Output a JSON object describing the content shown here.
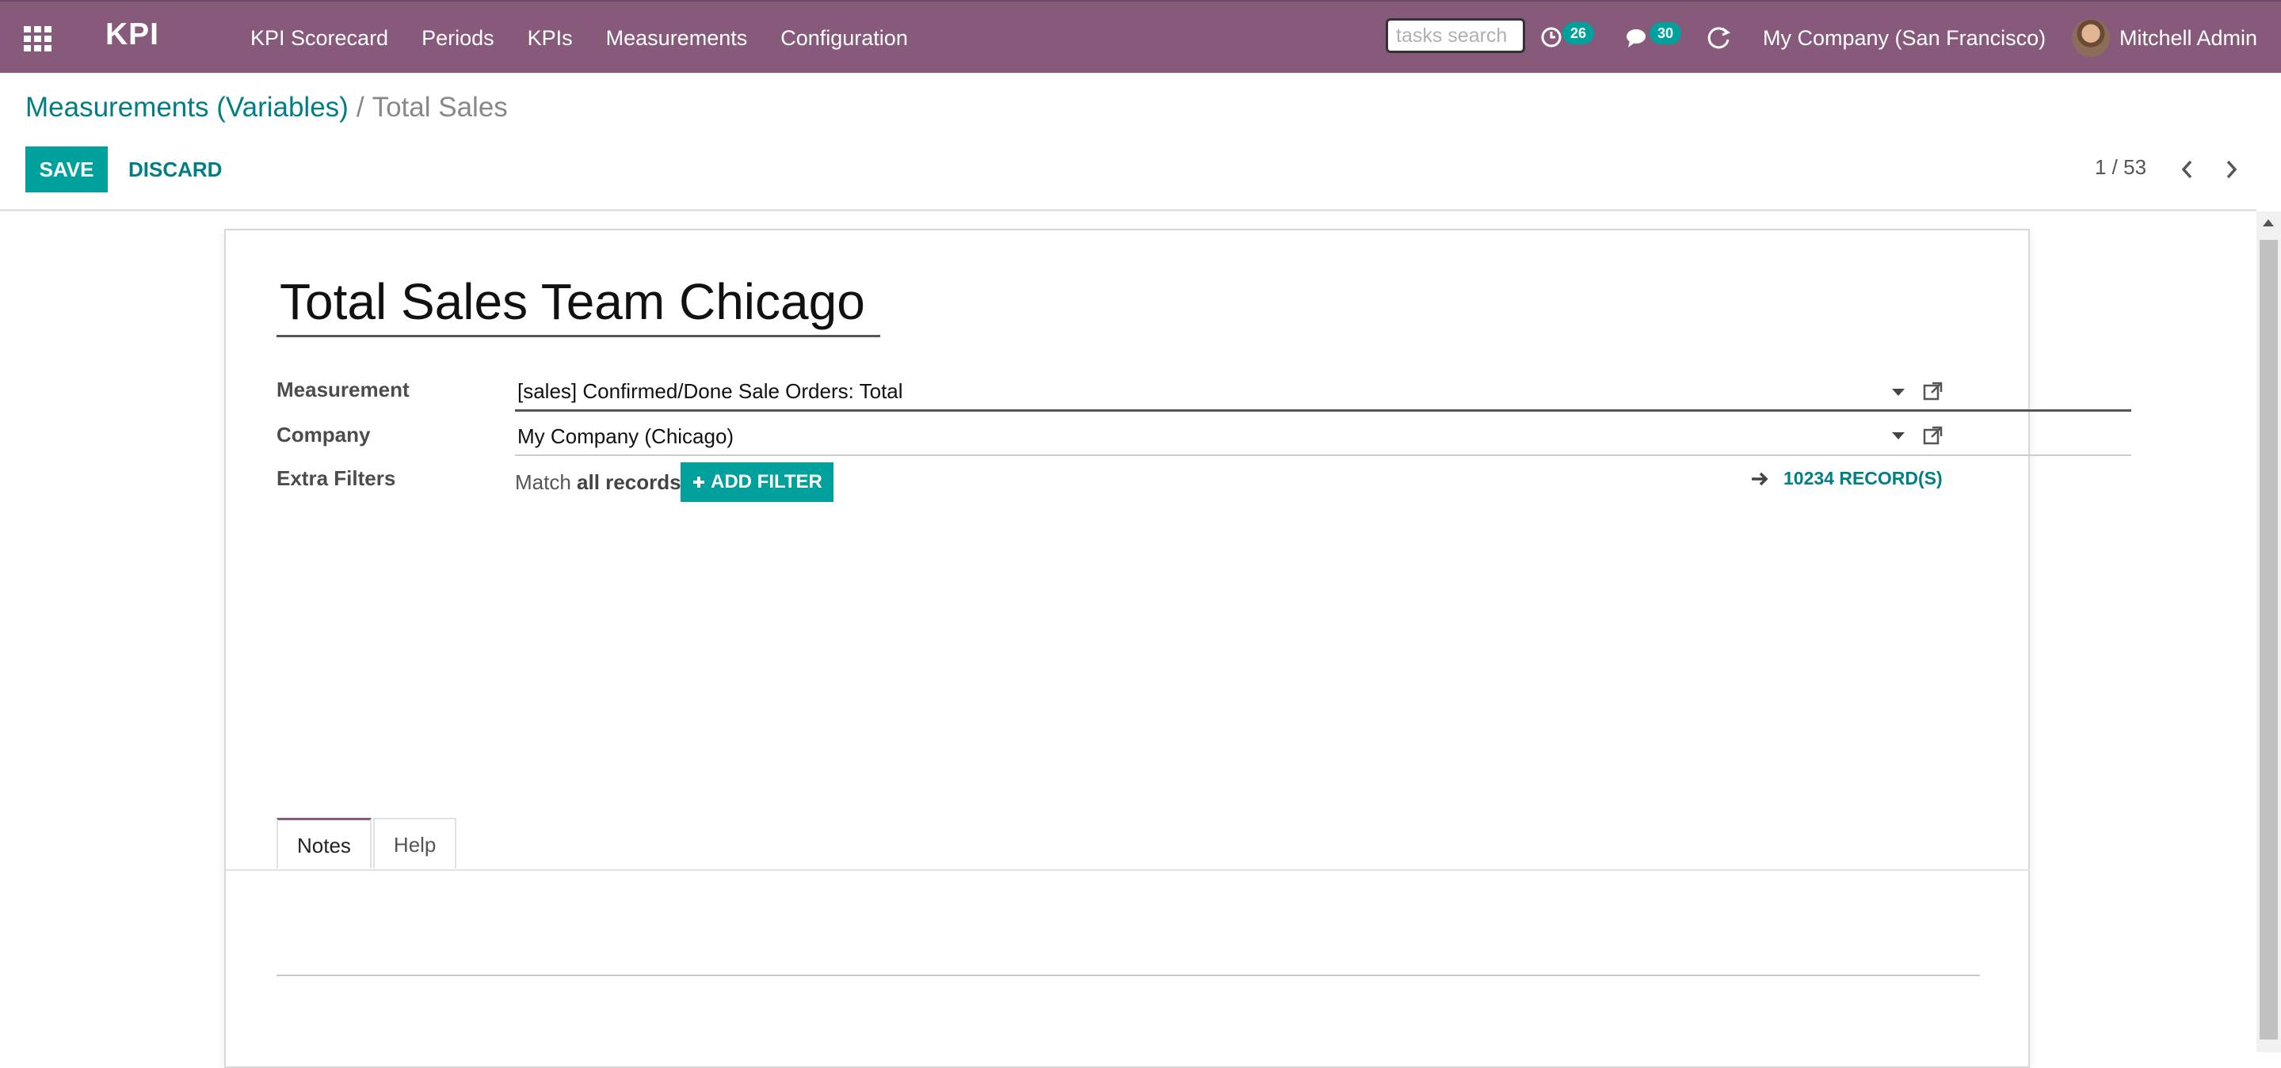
{
  "navbar": {
    "brand": "KPI",
    "menu": [
      "KPI Scorecard",
      "Periods",
      "KPIs",
      "Measurements",
      "Configuration"
    ],
    "search_placeholder": "tasks search",
    "activity_count": "26",
    "messages_count": "30",
    "company": "My Company (San Francisco)",
    "user": "Mitchell Admin"
  },
  "breadcrumb": {
    "parent": "Measurements (Variables)",
    "separator": "/",
    "current": "Total Sales"
  },
  "buttons": {
    "save": "SAVE",
    "discard": "DISCARD"
  },
  "pager": {
    "text": "1 / 53"
  },
  "form": {
    "title": "Total Sales Team Chicago",
    "fields": {
      "measurement": {
        "label": "Measurement",
        "value": "[sales] Confirmed/Done Sale Orders: Total"
      },
      "company": {
        "label": "Company",
        "value": "My Company (Chicago)"
      },
      "extra_filters": {
        "label": "Extra Filters",
        "match_prefix": "Match",
        "match_value": "all records",
        "add_filter": "ADD FILTER",
        "records": "10234 RECORD(S)"
      }
    },
    "tabs": [
      "Notes",
      "Help"
    ],
    "active_tab": "Notes"
  },
  "colors": {
    "navbar": "#875a7b",
    "primary": "#00a09d",
    "link": "#017e84"
  },
  "icons": [
    "apps-grid-icon",
    "clock-icon",
    "chat-icon",
    "refresh-icon",
    "chevron-left-icon",
    "chevron-right-icon",
    "dropdown-caret-icon",
    "external-link-icon",
    "plus-icon",
    "arrow-right-icon"
  ]
}
